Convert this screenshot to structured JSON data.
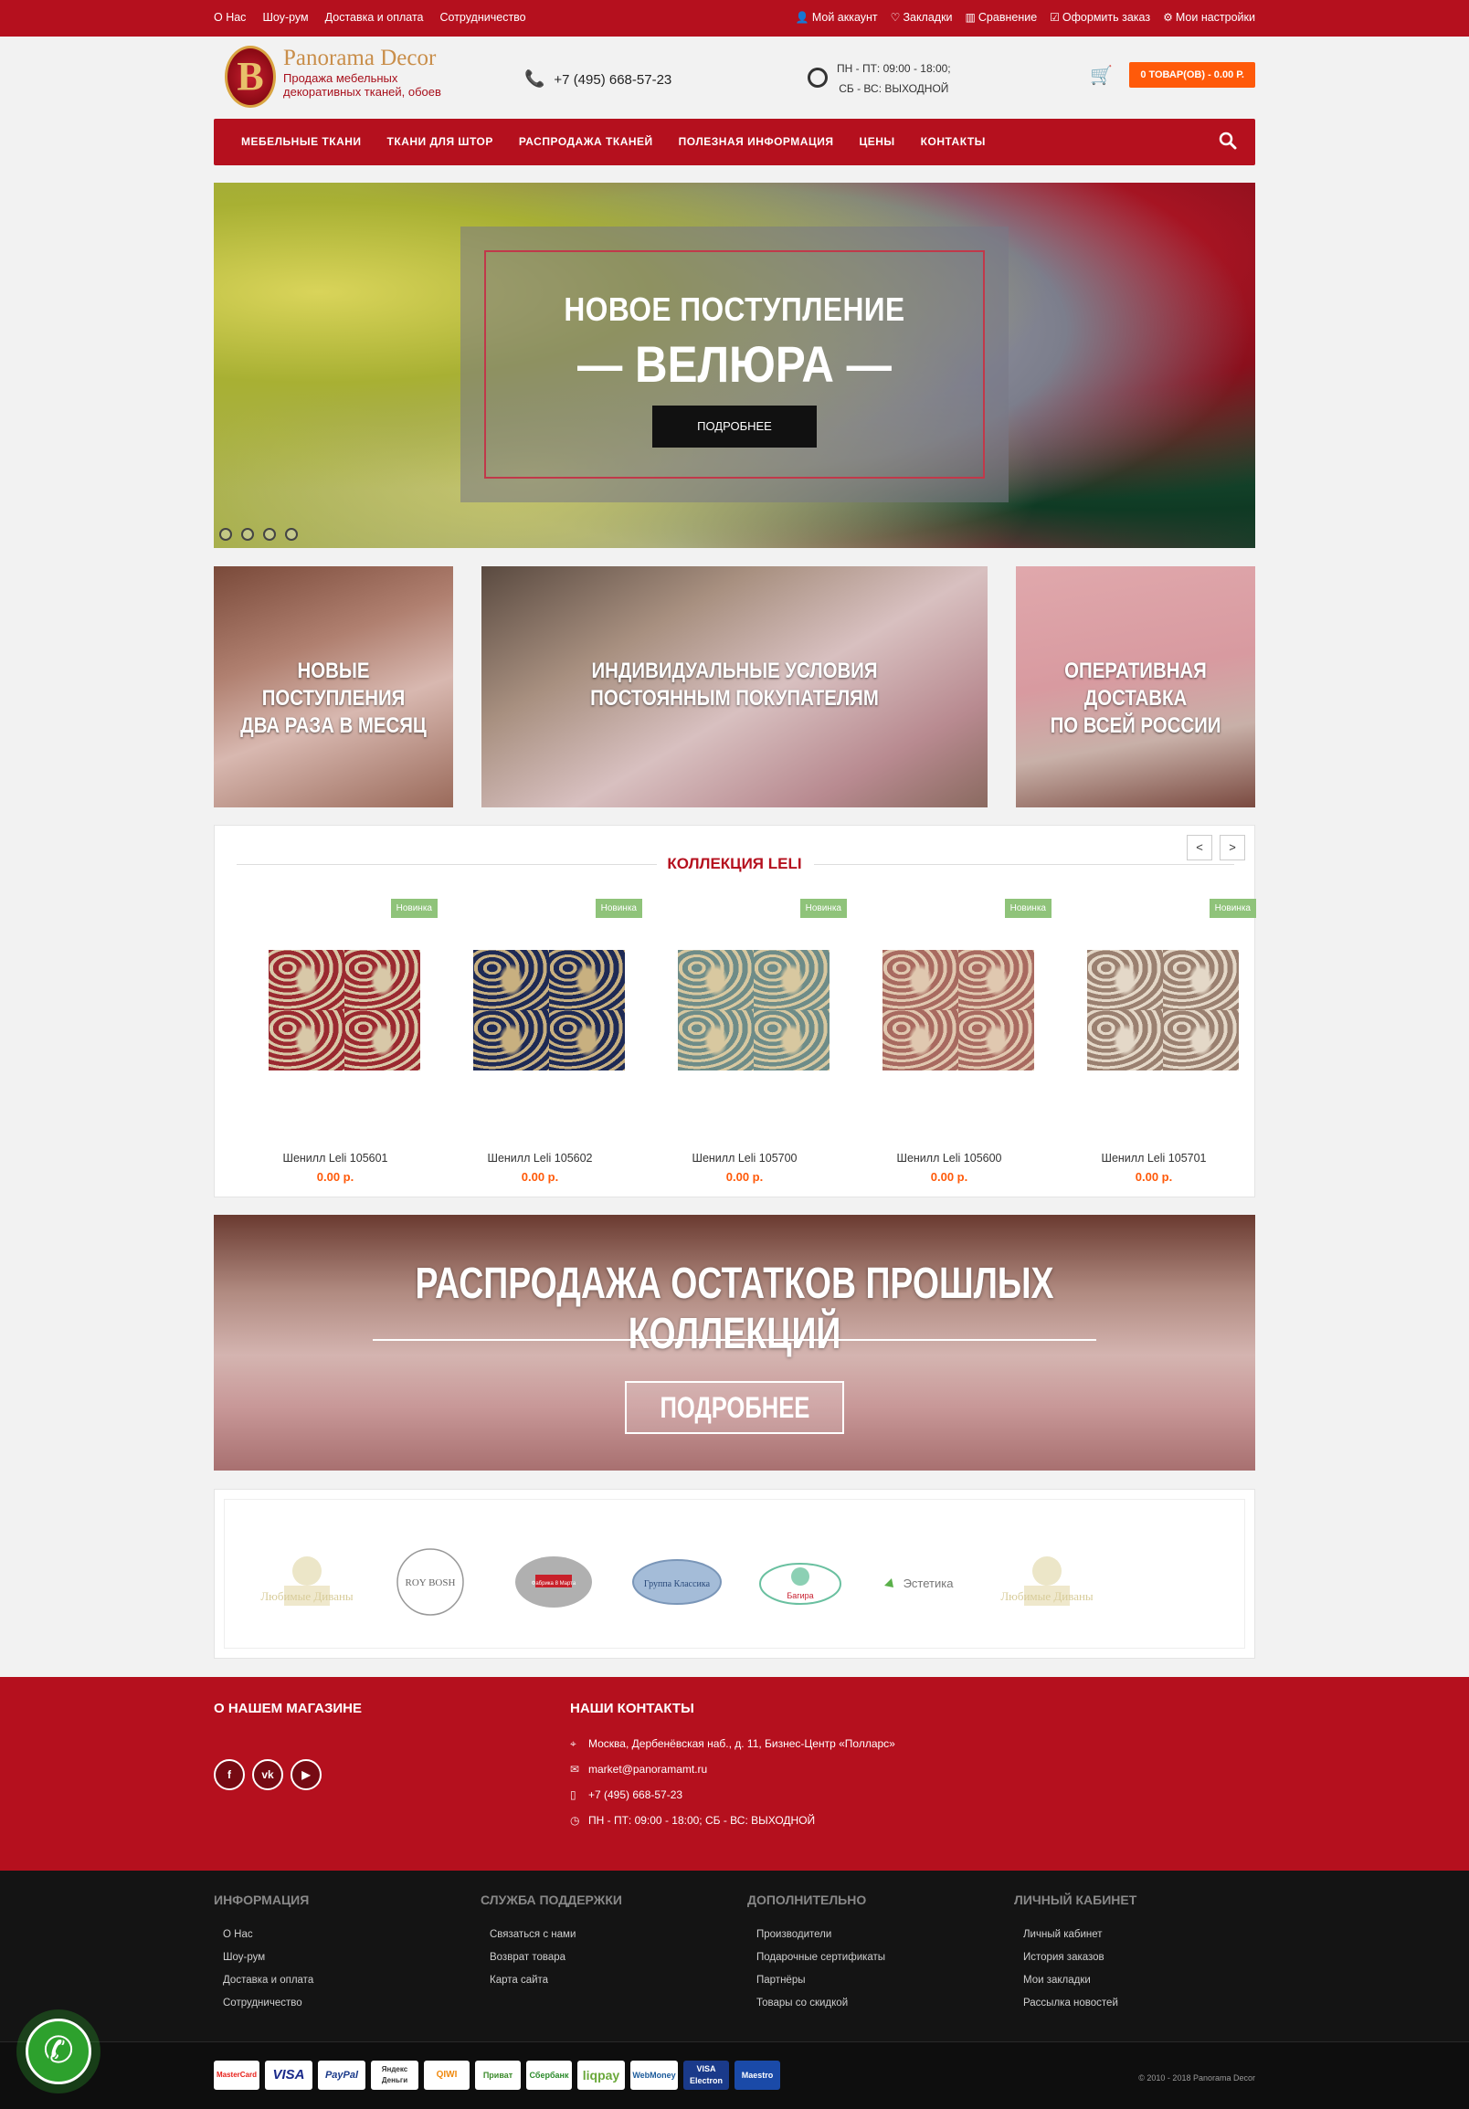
{
  "topbar": {
    "left": [
      "О Нас",
      "Шоу-рум",
      "Доставка и оплата",
      "Сотрудничество"
    ],
    "right": [
      {
        "icon": "user-icon",
        "label": "Мой аккаунт"
      },
      {
        "icon": "heart-icon",
        "label": "Закладки"
      },
      {
        "icon": "bar-chart-icon",
        "label": "Сравнение"
      },
      {
        "icon": "checkbox-icon",
        "label": "Оформить заказ"
      },
      {
        "icon": "gear-icon",
        "label": "Мои настройки"
      }
    ]
  },
  "header": {
    "logo_letter": "B",
    "logo_name": "Panorama Decor",
    "logo_sub": "Продажа мебельных декоративных тканей, обоев",
    "phone": "+7 (495) 668-57-23",
    "hours_1": "ПН - ПТ: 09:00 - 18:00;",
    "hours_2": "СБ - ВС: ВЫХОДНОЙ",
    "cart_label": "0 ТОВАР(ОВ) - 0.00 Р."
  },
  "nav": [
    "МЕБЕЛЬНЫЕ ТКАНИ",
    "ТКАНИ ДЛЯ ШТОР",
    "РАСПРОДАЖА ТКАНЕЙ",
    "ПОЛЕЗНАЯ ИНФОРМАЦИЯ",
    "ЦЕНЫ",
    "КОНТАКТЫ"
  ],
  "hero": {
    "line1": "НОВОЕ ПОСТУПЛЕНИЕ",
    "line2": "— ВЕЛЮРА —",
    "button": "ПОДРОБНЕЕ"
  },
  "banners": [
    {
      "l1": "НОВЫЕ ПОСТУПЛЕНИЯ",
      "l2": "ДВА РАЗА В МЕСЯЦ"
    },
    {
      "l1": "ИНДИВИДУАЛЬНЫЕ УСЛОВИЯ",
      "l2": "ПОСТОЯННЫМ ПОКУПАТЕЛЯМ"
    },
    {
      "l1": "ОПЕРАТИВНАЯ ДОСТАВКА",
      "l2": "ПО ВСЕЙ РОССИИ"
    }
  ],
  "collection": {
    "title": "КОЛЛЕКЦИЯ LELI",
    "prev": "<",
    "next": ">",
    "products": [
      {
        "badge": "Новинка",
        "name": "Шенилл Leli 105601",
        "price": "0.00 р.",
        "c1": "#9a2a30",
        "c2": "#d8c8a8"
      },
      {
        "badge": "Новинка",
        "name": "Шенилл Leli 105602",
        "price": "0.00 р.",
        "c1": "#1e2a55",
        "c2": "#c8b080"
      },
      {
        "badge": "Новинка",
        "name": "Шенилл Leli 105700",
        "price": "0.00 р.",
        "c1": "#6e8c88",
        "c2": "#d8c8a0"
      },
      {
        "badge": "Новинка",
        "name": "Шенилл Leli 105600",
        "price": "0.00 р.",
        "c1": "#a86a60",
        "c2": "#e0c8b0"
      },
      {
        "badge": "Новинка",
        "name": "Шенилл Leli 105701",
        "price": "0.00 р.",
        "c1": "#9a8070",
        "c2": "#e4d8c8"
      }
    ]
  },
  "sale": {
    "title": "РАСПРОДАЖА ОСТАТКОВ ПРОШЛЫХ КОЛЛЕКЦИЙ",
    "button": "ПОДРОБНЕЕ"
  },
  "brands": [
    {
      "name": "Любимые Диваны"
    },
    {
      "name": "ROY BOSH"
    },
    {
      "name": "Фабрика 8 Марта"
    },
    {
      "name": "Группа Классика"
    },
    {
      "name": "Багира"
    },
    {
      "name": "Эстетика"
    },
    {
      "name": "Любимые Диваны"
    }
  ],
  "footer_red": {
    "about_title": "О НАШЕМ МАГАЗИНЕ",
    "contacts_title": "НАШИ КОНТАКТЫ",
    "social": [
      "f",
      "vk",
      "▶"
    ],
    "contacts": [
      {
        "icon": "pin-icon",
        "text": "Москва, Дербенёвская наб., д. 11, Бизнес-Центр «Полларс»"
      },
      {
        "icon": "mail-icon",
        "text": "market@panoramamt.ru"
      },
      {
        "icon": "phone-icon",
        "text": "+7 (495) 668-57-23"
      },
      {
        "icon": "clock-icon",
        "text": "ПН - ПТ: 09:00 - 18:00; СБ - ВС: ВЫХОДНОЙ"
      }
    ]
  },
  "footer_cols": [
    {
      "title": "ИНФОРМАЦИЯ",
      "links": [
        "О Нас",
        "Шоу-рум",
        "Доставка и оплата",
        "Сотрудничество"
      ]
    },
    {
      "title": "СЛУЖБА ПОДДЕРЖКИ",
      "links": [
        "Связаться с нами",
        "Возврат товара",
        "Карта сайта"
      ]
    },
    {
      "title": "ДОПОЛНИТЕЛЬНО",
      "links": [
        "Производители",
        "Подарочные сертификаты",
        "Партнёры",
        "Товары со скидкой"
      ]
    },
    {
      "title": "ЛИЧНЫЙ КАБИНЕТ",
      "links": [
        "Личный кабинет",
        "История заказов",
        "Мои закладки",
        "Рассылка новостей"
      ]
    }
  ],
  "payments": [
    "MasterCard",
    "VISA",
    "PayPal",
    "Яндекс Деньги",
    "QIWI",
    "Приват",
    "Сбербанк",
    "liqpay",
    "WebMoney",
    "VISA Electron",
    "Maestro"
  ],
  "copyright": "© 2010 - 2018 Panorama Decor",
  "callback_icon": "phone-icon"
}
